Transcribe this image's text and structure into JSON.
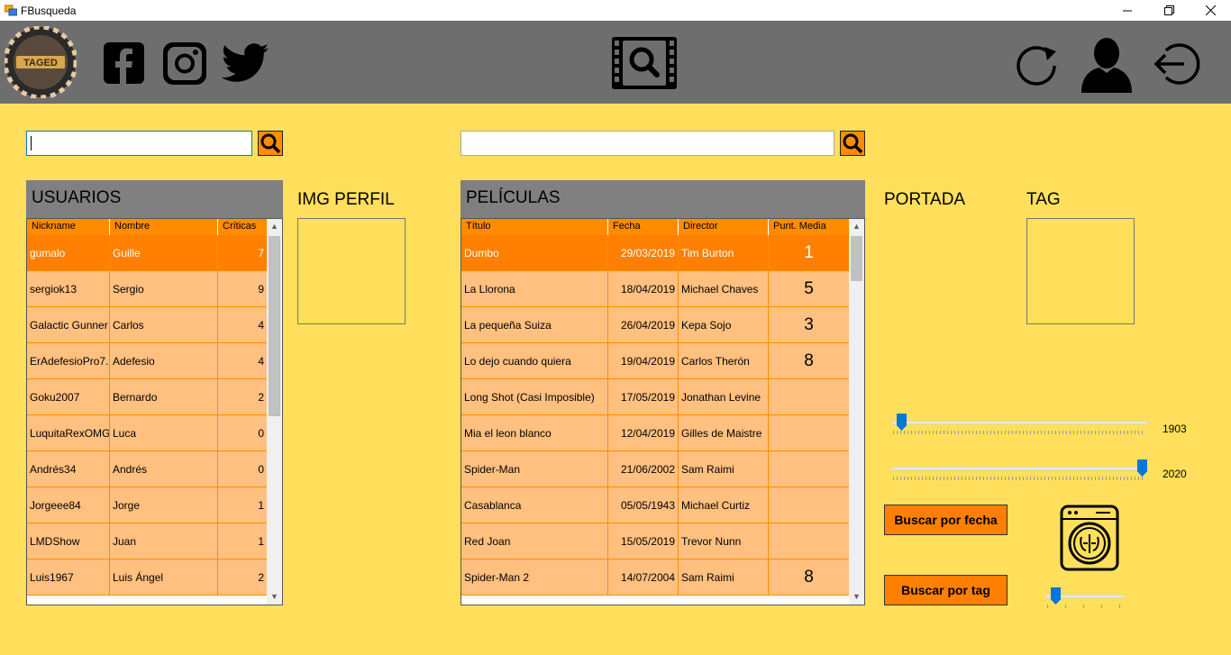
{
  "window": {
    "title": "FBusqueda"
  },
  "colors": {
    "background": "#FFDF5B",
    "topbar": "#6E6E6E",
    "accent": "#FF8C00",
    "row": "#FFC080",
    "row_selected": "#FF8000",
    "slider_thumb": "#0078D7"
  },
  "topbar": {
    "logo": {
      "text": "TAGED"
    },
    "social_icons": [
      "facebook-icon",
      "instagram-icon",
      "twitter-icon"
    ],
    "center_icon": "movie-search-icon",
    "right_icons": [
      "refresh-icon",
      "user-profile-icon",
      "logout-icon"
    ]
  },
  "search": {
    "users_value": "",
    "movies_value": ""
  },
  "users": {
    "title": "USUARIOS",
    "image_label": "IMG PERFIL",
    "columns": [
      "Nickname",
      "Nombre",
      "Críticas"
    ],
    "rows": [
      [
        "gumalo",
        "Guille",
        "7"
      ],
      [
        "sergiok13",
        "Sergio",
        "9"
      ],
      [
        "Galactic Gunner",
        "Carlos",
        "4"
      ],
      [
        "ErAdefesioPro7...",
        "Adefesio",
        "4"
      ],
      [
        "Goku2007",
        "Bernardo",
        "2"
      ],
      [
        "LuquitaRexOMG",
        "Luca",
        "0"
      ],
      [
        "Andrés34",
        "Andrés",
        "0"
      ],
      [
        "Jorgeee84",
        "Jorge",
        "1"
      ],
      [
        "LMDShow",
        "Juan",
        "1"
      ],
      [
        "Luis1967",
        "Luis Ángel",
        "2"
      ]
    ]
  },
  "movies": {
    "title": "PELÍCULAS",
    "columns": [
      "Título",
      "Fecha",
      "Director",
      "Punt. Media"
    ],
    "rows": [
      [
        "Dumbo",
        "29/03/2019",
        "Tim Burton",
        "1"
      ],
      [
        "La Llorona",
        "18/04/2019",
        "Michael Chaves",
        "5"
      ],
      [
        "La pequeña Suiza",
        "26/04/2019",
        "Kepa Sojo",
        "3"
      ],
      [
        "Lo dejo cuando quiera",
        "19/04/2019",
        "Carlos Therón",
        "8"
      ],
      [
        "Long Shot (Casi Imposible)",
        "17/05/2019",
        "Jonathan Levine",
        ""
      ],
      [
        "Mia el leon blanco",
        "12/04/2019",
        "Gilles de Maistre",
        ""
      ],
      [
        "Spider-Man",
        "21/06/2002",
        "Sam Raimi",
        ""
      ],
      [
        "Casablanca",
        "05/05/1943",
        "Michael Curtiz",
        ""
      ],
      [
        "Red Joan",
        "15/05/2019",
        "Trevor Nunn",
        ""
      ],
      [
        "Spider-Man 2",
        "14/07/2004",
        "Sam Raimi",
        "8"
      ]
    ]
  },
  "cover": {
    "title": "PORTADA"
  },
  "tag": {
    "title": "TAG"
  },
  "filters": {
    "year_min": "1903",
    "year_max": "2020",
    "year_min_fraction": 0.0,
    "year_max_fraction": 1.0,
    "tag_slider_fraction": 0.0,
    "by_date_label": "Buscar por fecha",
    "by_tag_label": "Buscar por tag",
    "tag_icon": "washing-machine-brain-icon"
  }
}
